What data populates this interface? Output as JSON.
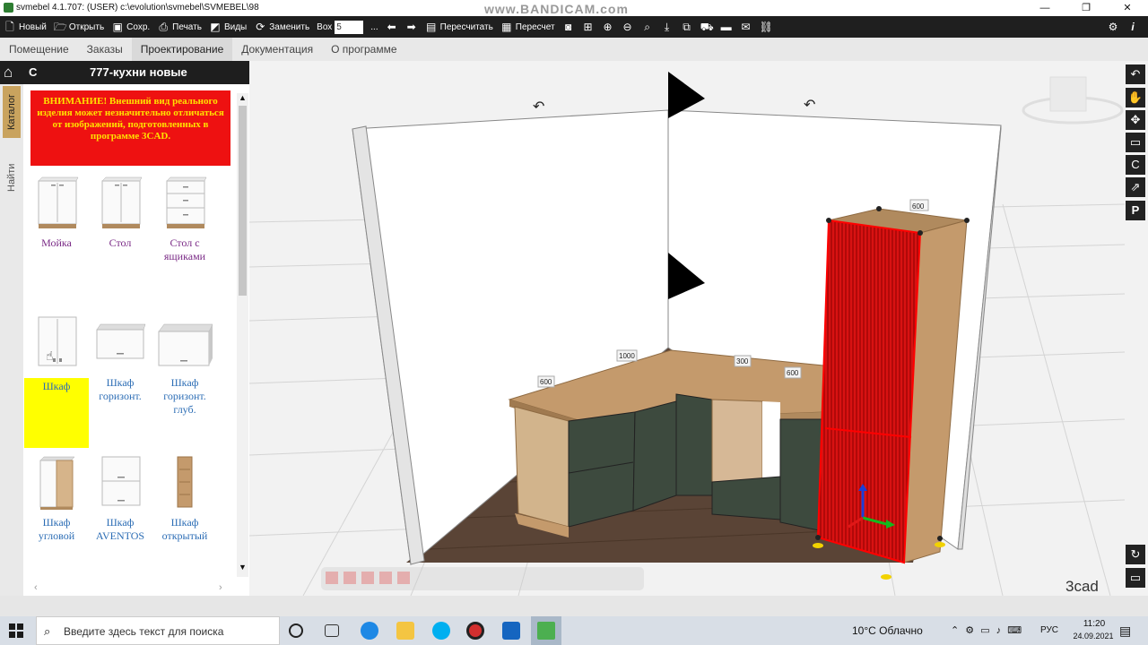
{
  "window": {
    "title": "svmebel 4.1.707: (USER)  c:\\evolution\\svmebel\\SVMEBEL\\98",
    "watermark": "www.BANDICAM.com",
    "minimize": "—",
    "restore": "❐",
    "close": "✕"
  },
  "toolbar": {
    "new": "Новый",
    "open": "Открыть",
    "save": "Сохр.",
    "print": "Печать",
    "views": "Виды",
    "replace": "Заменить",
    "vox_label": "Вох",
    "vox_value": "5",
    "dots": "...",
    "recalc": "Пересчитать",
    "recross": "Пересчет"
  },
  "menu": {
    "tabs": [
      "Помещение",
      "Заказы",
      "Проектирование",
      "Документация",
      "О программе"
    ],
    "active": "Проектирование"
  },
  "panel": {
    "c_label": "С",
    "title": "777-кухни новые",
    "tabs": {
      "catalog": "Каталог",
      "find": "Найти"
    },
    "warning": "ВНИМАНИЕ! Внешний вид реального изделия может незначительно отличаться от изображений, подготовленных в программе 3CAD.",
    "items": [
      {
        "label": "Мойка"
      },
      {
        "label": "Стол"
      },
      {
        "label": "Стол с ящиками"
      },
      {
        "label": "Шкаф"
      },
      {
        "label": "Шкаф горизонт."
      },
      {
        "label": "Шкаф горизонт. глуб."
      },
      {
        "label": "Шкаф угловой"
      },
      {
        "label": "Шкаф AVENTOS"
      },
      {
        "label": "Шкаф открытый"
      }
    ]
  },
  "viewport": {
    "dims": {
      "a": "600",
      "b": "1000",
      "c": "300",
      "d": "600",
      "e": "600"
    },
    "logo": "3cad"
  },
  "taskbar": {
    "search_placeholder": "Введите здесь текст для поиска",
    "weather": "10°C  Облачно",
    "lang": "РУС",
    "time": "11:20",
    "date": "24.09.2021"
  },
  "colors": {
    "accent": "#ee1111",
    "highlight": "#ffff00",
    "cabinet_front": "#3d4a3e",
    "wood": "#c49a6c"
  }
}
